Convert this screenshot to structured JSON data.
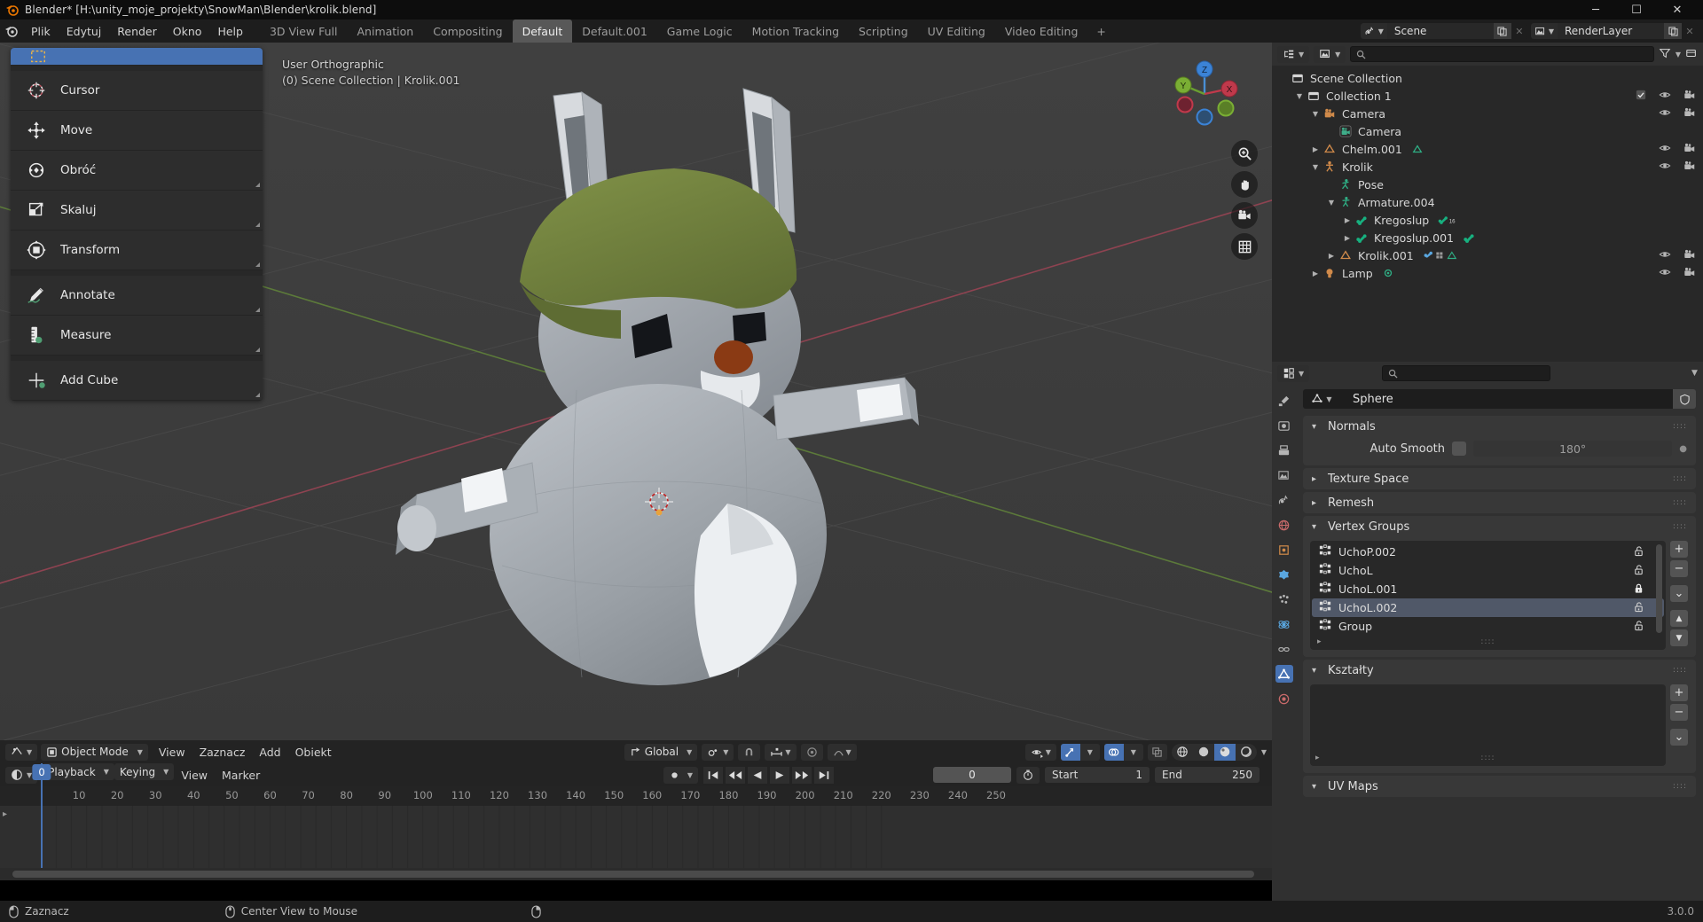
{
  "titlebar": {
    "title": "Blender* [H:\\unity_moje_projekty\\SnowMan\\Blender\\krolik.blend]",
    "minimize": "─",
    "maximize": "☐",
    "close": "✕"
  },
  "topbar": {
    "menus": [
      "Plik",
      "Edytuj",
      "Render",
      "Okno",
      "Help"
    ],
    "workspaces": [
      {
        "label": "3D View Full",
        "active": false
      },
      {
        "label": "Animation",
        "active": false
      },
      {
        "label": "Compositing",
        "active": false
      },
      {
        "label": "Default",
        "active": true
      },
      {
        "label": "Default.001",
        "active": false
      },
      {
        "label": "Game Logic",
        "active": false
      },
      {
        "label": "Motion Tracking",
        "active": false
      },
      {
        "label": "Scripting",
        "active": false
      },
      {
        "label": "UV Editing",
        "active": false
      },
      {
        "label": "Video Editing",
        "active": false
      }
    ],
    "add_workspace": "+",
    "scene_name": "Scene",
    "viewlayer_name": "RenderLayer"
  },
  "viewport": {
    "overlay_line1": "User Orthographic",
    "overlay_line2": "(0) Scene Collection | Krolik.001",
    "gizmo_axes": [
      "X",
      "Y",
      "Z"
    ],
    "nav_icons": [
      "zoom-icon",
      "hand-icon",
      "camera-icon",
      "grid-icon"
    ]
  },
  "toolbar": {
    "items": [
      {
        "label": "",
        "icon": "select-box-icon",
        "active": true
      },
      {
        "label": "Cursor",
        "icon": "cursor-icon",
        "active": false
      },
      {
        "label": "Move",
        "icon": "move-icon",
        "active": false
      },
      {
        "label": "Obróć",
        "icon": "rotate-icon",
        "active": false
      },
      {
        "label": "Skaluj",
        "icon": "scale-icon",
        "active": false
      },
      {
        "label": "Transform",
        "icon": "transform-icon",
        "active": false
      },
      {
        "label": "Annotate",
        "icon": "annotate-icon",
        "active": false
      },
      {
        "label": "Measure",
        "icon": "measure-icon",
        "active": false
      },
      {
        "label": "Add Cube",
        "icon": "add-cube-icon",
        "active": false
      }
    ]
  },
  "viewport_header": {
    "editor_type": "3d-viewport-icon",
    "mode": "Object Mode",
    "menus": [
      "View",
      "Zaznacz",
      "Add",
      "Obiekt"
    ],
    "transform_orientation": "Global",
    "pivot": "pivot-icon",
    "snap": "magnet-icon",
    "snap_to": "snap-increment-icon",
    "proportional": "proportional-edit-icon",
    "falloff": "falloff-icon",
    "visibility": "visibility-icon",
    "gizmo": "gizmo-icon",
    "overlays": "overlays-icon",
    "xray": "xray-icon",
    "shading_modes": [
      "wireframe",
      "solid",
      "material",
      "rendered"
    ],
    "shading_active": "material"
  },
  "timeline": {
    "editor_type": "timeline-icon",
    "menus": [
      "Playback",
      "Keying",
      "View",
      "Marker"
    ],
    "transport": [
      "jump-start",
      "prev-keyframe",
      "play-reverse",
      "play",
      "next-keyframe",
      "jump-end"
    ],
    "current_frame": "0",
    "start_label": "Start",
    "start_value": "1",
    "end_label": "End",
    "end_value": "250",
    "ruler_ticks": [
      "0",
      "10",
      "20",
      "30",
      "40",
      "50",
      "60",
      "70",
      "80",
      "90",
      "100",
      "110",
      "120",
      "130",
      "140",
      "150",
      "160",
      "170",
      "180",
      "190",
      "200",
      "210",
      "220",
      "230",
      "240",
      "250"
    ],
    "playhead_frame": "0"
  },
  "outliner": {
    "display_mode": "view-layer-icon",
    "filter_icon": "filter-icon",
    "search_placeholder": "",
    "rows": [
      {
        "label": "Scene Collection",
        "depth": 0,
        "tri": "",
        "icon": "collection-icon",
        "eye": false,
        "camera": false
      },
      {
        "label": "Collection 1",
        "depth": 1,
        "tri": "down",
        "icon": "collection-icon",
        "eye": true,
        "camera": true,
        "checkbox": true
      },
      {
        "label": "Camera",
        "depth": 2,
        "tri": "down",
        "icon": "camera-object-icon",
        "eye": true,
        "camera": true
      },
      {
        "label": "Camera",
        "depth": 3,
        "tri": "",
        "icon": "camera-data-icon",
        "eye": false,
        "camera": false
      },
      {
        "label": "Chelm.001",
        "depth": 2,
        "tri": "right",
        "icon": "mesh-object-icon",
        "eye": true,
        "camera": true,
        "extra": "mesh-data-icon"
      },
      {
        "label": "Krolik",
        "depth": 2,
        "tri": "down",
        "icon": "armature-object-icon",
        "eye": true,
        "camera": true
      },
      {
        "label": "Pose",
        "depth": 3,
        "tri": "",
        "icon": "pose-icon",
        "eye": false,
        "camera": false
      },
      {
        "label": "Armature.004",
        "depth": 3,
        "tri": "down",
        "icon": "armature-data-icon",
        "eye": false,
        "camera": false
      },
      {
        "label": "Kregoslup",
        "depth": 4,
        "tri": "right",
        "icon": "bone-icon",
        "eye": false,
        "camera": false,
        "extra": "bone-count-icon"
      },
      {
        "label": "Kregoslup.001",
        "depth": 4,
        "tri": "right",
        "icon": "bone-icon",
        "eye": false,
        "camera": false,
        "extra": "bone-icon"
      },
      {
        "label": "Krolik.001",
        "depth": 3,
        "tri": "right",
        "icon": "mesh-object-icon",
        "eye": true,
        "camera": true,
        "extra": "modifier-icons"
      },
      {
        "label": "Lamp",
        "depth": 2,
        "tri": "right",
        "icon": "light-object-icon",
        "eye": true,
        "camera": true,
        "extra": "light-data-icon"
      }
    ]
  },
  "properties": {
    "editor_type": "properties-icon",
    "search_placeholder": "",
    "tabs": [
      "tool-icon",
      "render-icon",
      "output-icon",
      "viewlayer-icon",
      "scene-icon",
      "world-icon",
      "object-icon",
      "modifier-icon",
      "particles-icon",
      "physics-icon",
      "constraint-icon",
      "data-icon",
      "material-icon"
    ],
    "active_tab_index": 11,
    "datablock_name": "Sphere",
    "datablock_icon": "mesh-data-icon",
    "shield_icon": "fake-user-icon",
    "panels": [
      {
        "title": "Normals",
        "open": true
      },
      {
        "title": "Texture Space",
        "open": false
      },
      {
        "title": "Remesh",
        "open": false
      },
      {
        "title": "Vertex Groups",
        "open": true
      },
      {
        "title": "Kształty",
        "open": true
      },
      {
        "title": "UV Maps",
        "open": true
      }
    ],
    "normals": {
      "auto_smooth_label": "Auto Smooth",
      "auto_smooth_checked": false,
      "angle_value": "180°"
    },
    "vertex_groups": [
      {
        "name": "UchoP.002",
        "locked": false,
        "selected": false
      },
      {
        "name": "UchoL",
        "locked": false,
        "selected": false
      },
      {
        "name": "UchoL.001",
        "locked": true,
        "selected": false
      },
      {
        "name": "UchoL.002",
        "locked": false,
        "selected": true
      },
      {
        "name": "Group",
        "locked": false,
        "selected": false
      }
    ],
    "vg_buttons": [
      "+",
      "−",
      "⌄",
      "▲",
      "▼"
    ]
  },
  "statusbar": {
    "items": [
      {
        "icon": "mouse-left-icon",
        "label": "Zaznacz"
      },
      {
        "icon": "mouse-middle-icon",
        "label": "Center View to Mouse"
      },
      {
        "icon": "mouse-right-icon",
        "label": ""
      }
    ],
    "version": "3.0.0"
  },
  "colors": {
    "accent": "#4772b3",
    "header": "#232323",
    "panel": "#383838",
    "viewport_bg": "#3b3b3b",
    "helmet_green": "#6e7f3c",
    "body_grey": "#9aa0a6",
    "nose_brown": "#8a3a14"
  }
}
